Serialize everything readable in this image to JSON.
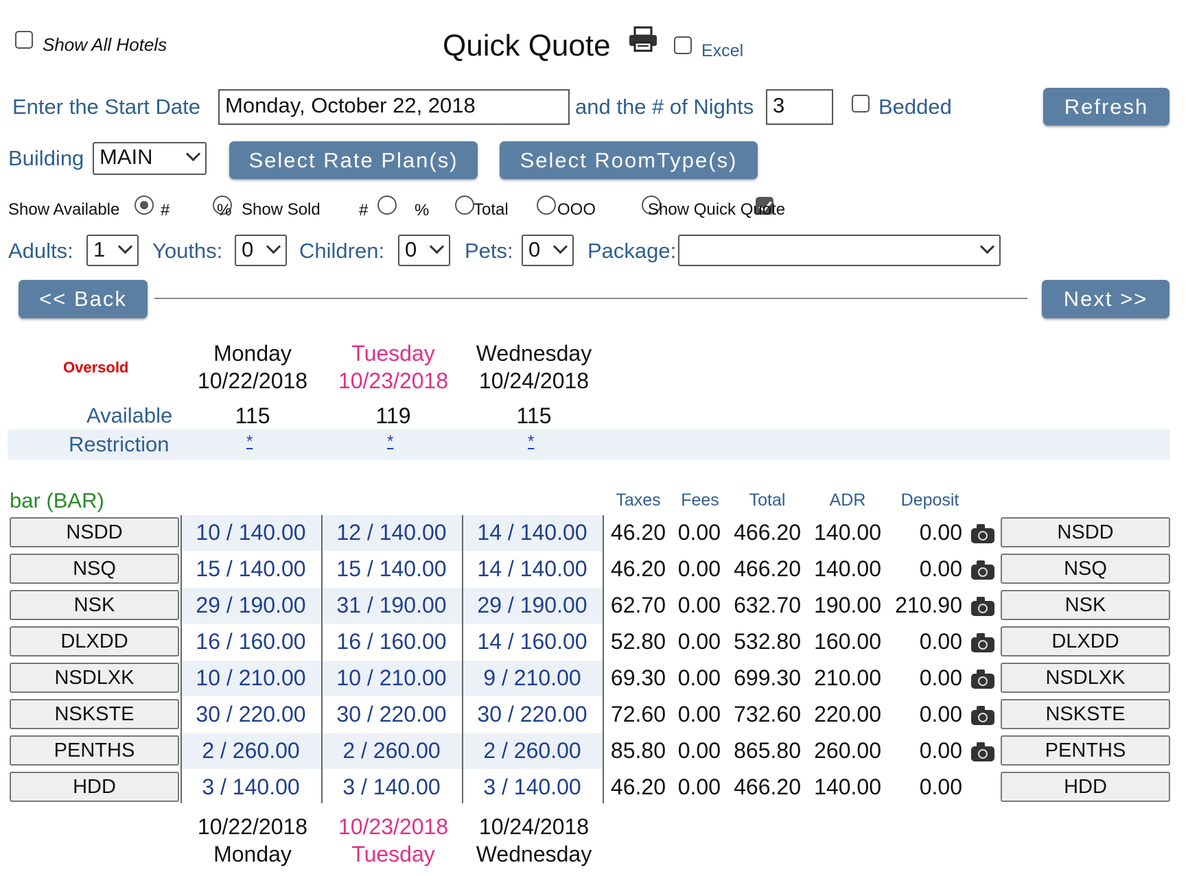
{
  "header": {
    "show_all_hotels": "Show All Hotels",
    "title": "Quick Quote",
    "excel": "Excel",
    "print_icon": "printer-icon"
  },
  "form": {
    "start_date_label": "Enter the Start Date",
    "start_date_value": "Monday, October 22, 2018",
    "nights_label": "and the # of Nights",
    "nights_value": "3",
    "bedded": "Bedded",
    "refresh": "Refresh",
    "building_label": "Building",
    "building_value": "MAIN",
    "select_rate_plans": "Select Rate Plan(s)",
    "select_room_types": "Select RoomType(s)",
    "show_available": "Show Available",
    "hash": "#",
    "percent": "%",
    "show_sold": "Show Sold",
    "total": "Total",
    "ooo": "OOO",
    "show_quick_quote": "Show Quick Quote",
    "adults_label": "Adults:",
    "adults_value": "1",
    "youths_label": "Youths:",
    "youths_value": "0",
    "children_label": "Children:",
    "children_value": "0",
    "pets_label": "Pets:",
    "pets_value": "0",
    "package_label": "Package:",
    "package_value": ""
  },
  "nav": {
    "back": "<< Back",
    "next": "Next >>"
  },
  "summary": {
    "oversold": "Oversold",
    "available_label": "Available",
    "restriction_label": "Restriction",
    "days": [
      {
        "name": "Monday",
        "date": "10/22/2018",
        "available": "115",
        "restriction": "*"
      },
      {
        "name": "Tuesday",
        "date": "10/23/2018",
        "available": "119",
        "restriction": "*"
      },
      {
        "name": "Wednesday",
        "date": "10/24/2018",
        "available": "115",
        "restriction": "*"
      }
    ]
  },
  "rate_plan": {
    "name": "bar (BAR)",
    "headers": {
      "taxes": "Taxes",
      "fees": "Fees",
      "total": "Total",
      "adr": "ADR",
      "deposit": "Deposit"
    },
    "rows": [
      {
        "room": "NSDD",
        "d1": "10 / 140.00",
        "d2": "12 / 140.00",
        "d3": "14 / 140.00",
        "taxes": "46.20",
        "fees": "0.00",
        "total": "466.20",
        "adr": "140.00",
        "deposit": "0.00",
        "camera": true
      },
      {
        "room": "NSQ",
        "d1": "15 / 140.00",
        "d2": "15 / 140.00",
        "d3": "14 / 140.00",
        "taxes": "46.20",
        "fees": "0.00",
        "total": "466.20",
        "adr": "140.00",
        "deposit": "0.00",
        "camera": true
      },
      {
        "room": "NSK",
        "d1": "29 / 190.00",
        "d2": "31 / 190.00",
        "d3": "29 / 190.00",
        "taxes": "62.70",
        "fees": "0.00",
        "total": "632.70",
        "adr": "190.00",
        "deposit": "210.90",
        "camera": true
      },
      {
        "room": "DLXDD",
        "d1": "16 / 160.00",
        "d2": "16 / 160.00",
        "d3": "14 / 160.00",
        "taxes": "52.80",
        "fees": "0.00",
        "total": "532.80",
        "adr": "160.00",
        "deposit": "0.00",
        "camera": true
      },
      {
        "room": "NSDLXK",
        "d1": "10 / 210.00",
        "d2": "10 / 210.00",
        "d3": "9 / 210.00",
        "taxes": "69.30",
        "fees": "0.00",
        "total": "699.30",
        "adr": "210.00",
        "deposit": "0.00",
        "camera": true
      },
      {
        "room": "NSKSTE",
        "d1": "30 / 220.00",
        "d2": "30 / 220.00",
        "d3": "30 / 220.00",
        "taxes": "72.60",
        "fees": "0.00",
        "total": "732.60",
        "adr": "220.00",
        "deposit": "0.00",
        "camera": true
      },
      {
        "room": "PENTHS",
        "d1": "2 / 260.00",
        "d2": "2 / 260.00",
        "d3": "2 / 260.00",
        "taxes": "85.80",
        "fees": "0.00",
        "total": "865.80",
        "adr": "260.00",
        "deposit": "0.00",
        "camera": true
      },
      {
        "room": "HDD",
        "d1": "3 / 140.00",
        "d2": "3 / 140.00",
        "d3": "3 / 140.00",
        "taxes": "46.20",
        "fees": "0.00",
        "total": "466.20",
        "adr": "140.00",
        "deposit": "0.00",
        "camera": false
      }
    ]
  },
  "colors": {
    "accent_button": "#5b7fa3",
    "label_blue": "#2f5f8f",
    "weekend_pink": "#e0308a",
    "oversold_red": "#e00000",
    "plan_green": "#2a8a2a"
  }
}
